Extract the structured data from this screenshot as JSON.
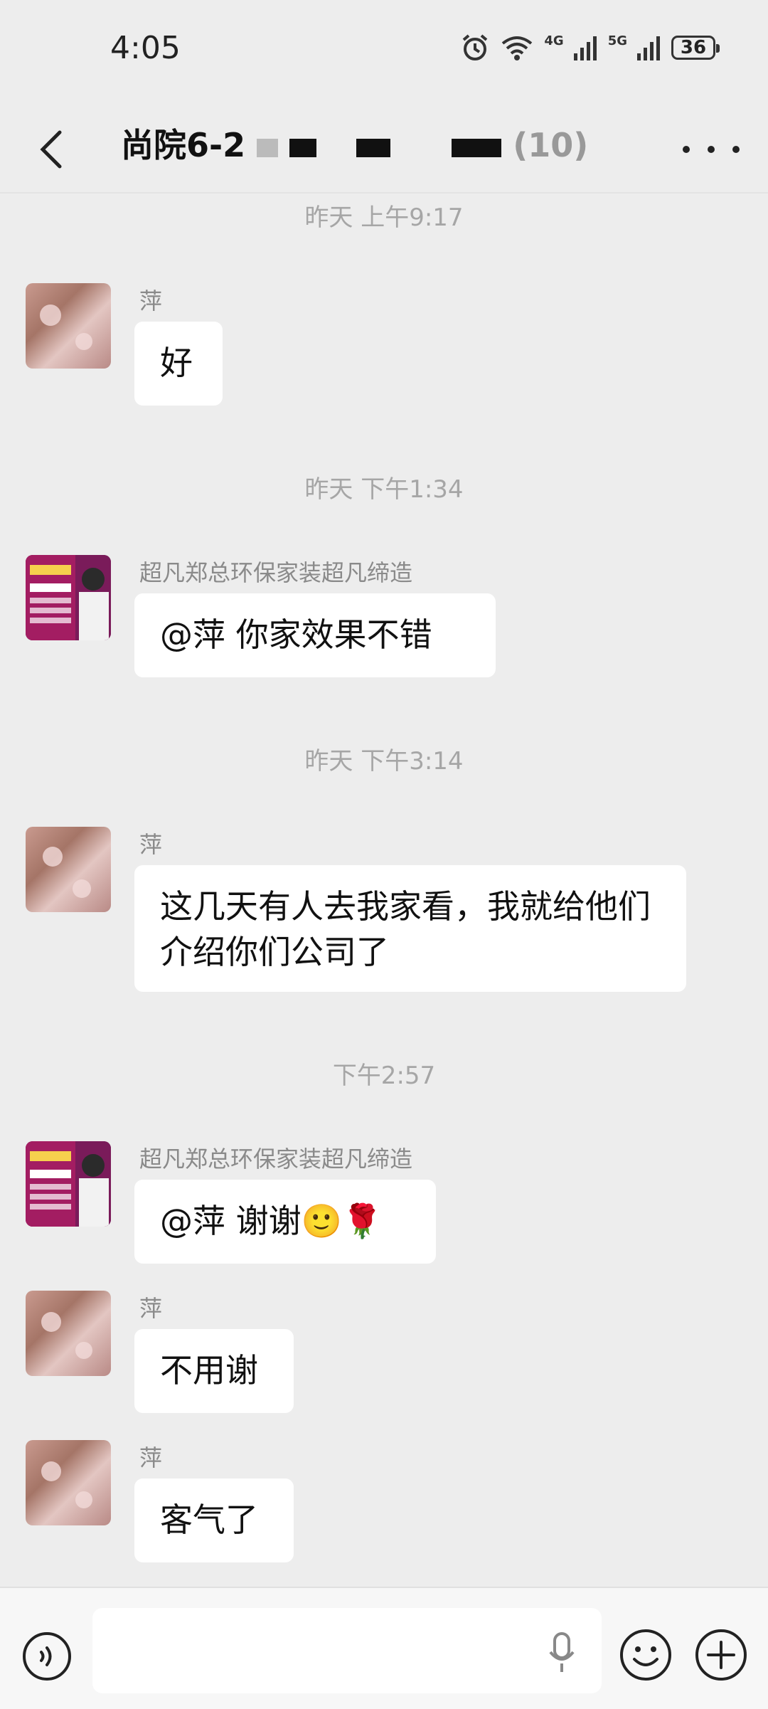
{
  "status_bar": {
    "time": "4:05",
    "net1": "4G",
    "net2": "5G",
    "battery": "36"
  },
  "header": {
    "title_visible": "尚院6-2",
    "title_tail": "(10)"
  },
  "messages": [
    {
      "timestamp": "昨天 上午9:17",
      "sender": "萍",
      "text": "好",
      "avatar": "flower"
    },
    {
      "timestamp": "昨天 下午1:34",
      "sender": "超凡郑总环保家装超凡缔造",
      "text": "@萍  你家效果不错",
      "avatar": "promo"
    },
    {
      "timestamp": "昨天 下午3:14",
      "sender": "萍",
      "text": "这几天有人去我家看，我就给他们介绍你们公司了",
      "avatar": "flower"
    },
    {
      "timestamp": "下午2:57",
      "sender": "超凡郑总环保家装超凡缔造",
      "text": "@萍  谢谢🙂🌹",
      "avatar": "promo"
    },
    {
      "sender": "萍",
      "text": "不用谢",
      "avatar": "flower"
    },
    {
      "sender": "萍",
      "text": "客气了",
      "avatar": "flower"
    }
  ],
  "input": {
    "placeholder": ""
  },
  "colors": {
    "background": "#ededed",
    "bubble": "#ffffff",
    "timestamp": "#a6a6a6"
  }
}
